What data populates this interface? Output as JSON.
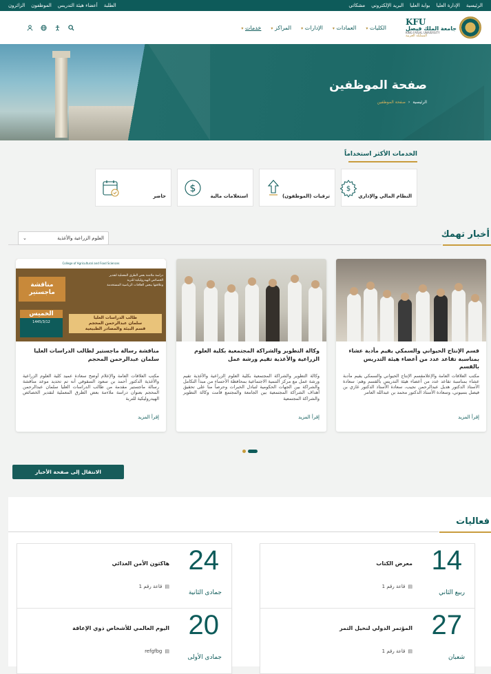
{
  "topbar": {
    "right_links": [
      "الرئيسية",
      "الإدارة العليا",
      "بوابة العليا",
      "البريد الإلكتروني",
      "مشكاتي"
    ],
    "left_links": [
      "الطلبة",
      "أعضاء هيئة التدريس",
      "الموظفون",
      "الزائرون"
    ]
  },
  "logo": {
    "kfu": "KFU",
    "ar": "جامعة الملك فيصل",
    "en": "KING FAISAL UNIVERSITY",
    "sub": "المملكة العربية"
  },
  "nav": {
    "items": [
      "الكليات",
      "العمادات",
      "الإدارات",
      "المراكز",
      "خدمات"
    ]
  },
  "hero": {
    "title": "صفحة الموظفين",
    "crumb_home": "الرئيسية",
    "crumb_sep": "‹",
    "crumb_current": "صفحة الموظفين"
  },
  "services": {
    "title": "الخدمات الأكثر استخداماً",
    "items": [
      {
        "label": "النظام المالي والإداري",
        "icon": "gear-dollar-icon"
      },
      {
        "label": "ترقيات (الموظفون)",
        "icon": "arrow-up-icon"
      },
      {
        "label": "استعلامات مالية",
        "icon": "dollar-coin-icon"
      },
      {
        "label": "حاضر",
        "icon": "calendar-check-icon"
      }
    ]
  },
  "news": {
    "title": "أخبار تهمك",
    "filter_value": "العلوم الزراعية والأغذية",
    "more_label": "إقرأ المزيد",
    "cards": [
      {
        "title": "قسم الإنتاج الحيواني والسمكي يقيم مأدبة عشاء بمناسبة تقاعد عدد من أعضاء هيئة التدريس بالقسم",
        "body": "مكتب العلاقات العامة والإعلامقسم الإنتاج الحيواني والسمكي يقيم مأدبة عشاء بمناسبة تقاعد عدد من أعضاء هيئة التدريس بالقسم وهم: سعادة الأستاذ الدكتور هديل عبدالرحمن نجيب، سعادة الأستاذ الدكتور غازي بن فيصل بسيوني، وسعادة الأستاذ الدكتور محمد بن عبدالله العامر"
      },
      {
        "title": "وكالة التطوير والشراكة المجتمعية بكلية العلوم الزراعية والأغذية تقيم ورشة عمل",
        "body": "وكالة التطوير والشراكة المجتمعية بكلية العلوم الزراعية والأغذية تقيم ورشة عمل مع مركز التنمية الاجتماعية بمحافظة الأحساء من مبدأ التكامل والشراكة بين الجهات الحكومية لتبادل الخبرات وحرصاً منا على تحقيق أهداف الشراكة المجتمعية بين الجامعة والمجتمع قامت وكالة التطوير والشراكة المجتمعية"
      },
      {
        "title": "مناقشة رسالة ماجستير لطالب الدراسات العليا سلمان عبدالرحمن المحجم",
        "body": "مكتب العلاقات العامة والإعلام أوضح سعادة عميد كلية العلوم الزراعية والأغذية الدكتور أحمد بن سعود السقوفي أنه تم تحديد موعد مناقشة رسالة ماجستير مقدمة من طالب الدراسات العليا سلمان عبدالرحمن المحجم بعنوان دراسة ملاءمة بعض الطرق المعملية لتقدير الخصائص الهيدروليكية للتربة"
      }
    ],
    "poster": {
      "college": "College of Agricultural and Food Sciences",
      "badge": "مناقشة ماجستير",
      "line1": "دراسة ملاءمة بعض الطرق المعملية لتقدير",
      "line2": "الخصائص الهيدروليكية للتربة",
      "line3": "وعلاقتها ببعض العلاقات الرياضية المستخدمة",
      "day": "الخميس",
      "date": "1445/3/12",
      "student_label": "طالب الدراسات العليا",
      "student": "سلمان عبدالرحمن المحجم",
      "dept": "قسم البيئة والمصادر الطبيعية"
    },
    "button_label": "الانتقال إلى صفحة الأخبار",
    "carousel": {
      "count": 2,
      "active": 0
    }
  },
  "events": {
    "title": "فعاليات",
    "items": [
      {
        "day": "14",
        "month": "ربيع الثاني",
        "name": "معرض الكتاب",
        "location": "قاعة رقم 1"
      },
      {
        "day": "24",
        "month": "جمادى الثانية",
        "name": "هاكثون الأمن الغذائي",
        "location": "قاعة رقم 1"
      },
      {
        "day": "27",
        "month": "شعبان",
        "name": "المؤتمر الدولي لنخيل التمر",
        "location": "قاعة رقم 1"
      },
      {
        "day": "20",
        "month": "جمادى الأولى",
        "name": "اليوم العالمي للأشخاص ذوي الإعاقة",
        "location": "refgfbg"
      }
    ]
  },
  "colors": {
    "primary": "#0e5b5a",
    "accent": "#c89b3c"
  }
}
